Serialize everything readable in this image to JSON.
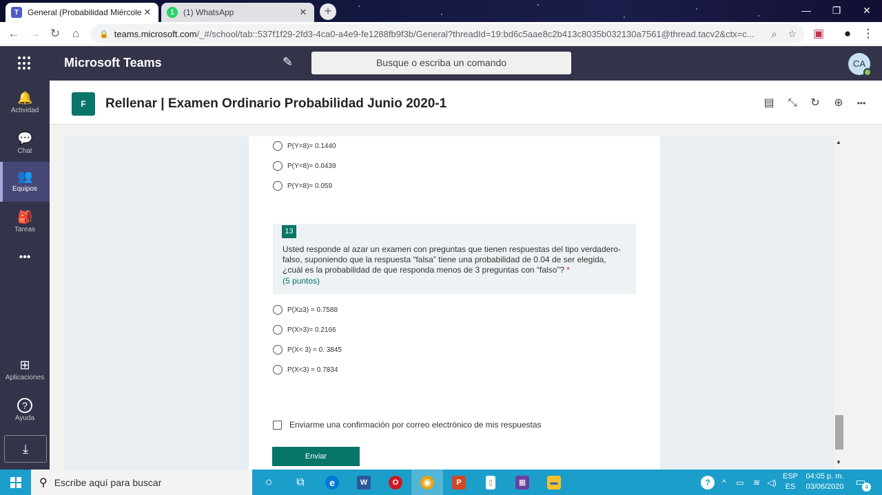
{
  "browser": {
    "tabs": [
      {
        "title": "General (Probabilidad Miércoles",
        "close": "✕",
        "active": true
      },
      {
        "title": "(1) WhatsApp",
        "badge": "1",
        "close": "✕",
        "active": false
      }
    ],
    "new_tab": "+",
    "window_controls": {
      "minimize": "—",
      "maximize": "❐",
      "close": "✕"
    },
    "nav": {
      "back": "←",
      "forward": "→",
      "reload": "↻",
      "home": "⌂"
    },
    "url_host": "teams.microsoft.com",
    "url_path": "/_#/school/tab::537f1f29-2fd3-4ca0-a4e9-fe1288fb9f3b/General?threadId=19:bd6c5aae8c2b413c8035b032130a7561@thread.tacv2&ctx=c...",
    "omnibox_icons": [
      "zoom-icon",
      "star-icon",
      "pocket-icon",
      "account-icon",
      "menu-icon"
    ]
  },
  "teams": {
    "app_title": "Microsoft Teams",
    "search_placeholder": "Busque o escriba un comando",
    "avatar_initials": "CA",
    "rail": [
      {
        "label": "Actividad",
        "icon": "bell-icon",
        "glyph": "🔔"
      },
      {
        "label": "Chat",
        "icon": "chat-icon",
        "glyph": "💬"
      },
      {
        "label": "Equipos",
        "icon": "teams-icon",
        "glyph": "👥",
        "active": true
      },
      {
        "label": "Tareas",
        "icon": "backpack-icon",
        "glyph": "🎒"
      },
      {
        "label": "•••",
        "icon": "more-icon",
        "glyph": ""
      },
      {
        "label": "Aplicaciones",
        "icon": "apps-icon",
        "glyph": "⊞"
      },
      {
        "label": "Ayuda",
        "icon": "help-icon",
        "glyph": "?"
      }
    ],
    "download_glyph": "⤓"
  },
  "channel": {
    "title": "Rellenar | Examen Ordinario Probabilidad Junio 2020-1",
    "logo_letter": "F",
    "header_icons": {
      "conversation": "▤",
      "collapse": "⤡",
      "refresh": "↻",
      "globe": "⊕",
      "more": "•••"
    }
  },
  "form": {
    "prev_options": [
      "P(Y=8)= 0.1440",
      "P(Y=8)= 0.0439",
      "P(Y=8)= 0.059"
    ],
    "question": {
      "number": "13",
      "text": "Usted responde al azar un examen con preguntas que tienen respuestas del tipo verdadero-falso, suponiendo que la respuesta “falsa” tiene una probabilidad de 0.04 de ser elegida, ¿cuál es la probabilidad de que responda menos de 3 preguntas con “falso”?",
      "required_mark": "*",
      "points": "(5 puntos)"
    },
    "options": [
      "P(X≥3) = 0.7588",
      "P(X>3)= 0.2166",
      "P(X< 3) = 0. 3845",
      "P(X<3) = 0.7834"
    ],
    "email_confirm": "Enviarme una confirmación por correo electrónico de mis respuestas",
    "submit_label": "Enviar"
  },
  "taskbar": {
    "search_placeholder": "Escribe aquí para buscar",
    "apps": [
      {
        "name": "cortana",
        "glyph": "○",
        "color": "transparent"
      },
      {
        "name": "task-view",
        "glyph": "⧉",
        "color": "transparent"
      },
      {
        "name": "edge",
        "glyph": "e",
        "color": "#0078d7"
      },
      {
        "name": "word",
        "glyph": "W",
        "color": "#2b579a"
      },
      {
        "name": "opera",
        "glyph": "O",
        "color": "#cc1b22"
      },
      {
        "name": "chrome",
        "glyph": "◉",
        "color": "#e8a317",
        "active": true
      },
      {
        "name": "powerpoint",
        "glyph": "P",
        "color": "#d24726"
      },
      {
        "name": "notepad",
        "glyph": "▯",
        "color": "#ffffff"
      },
      {
        "name": "calculator",
        "glyph": "▦",
        "color": "#6b3fa0"
      },
      {
        "name": "file-explorer",
        "glyph": "▬",
        "color": "#f2c12e"
      }
    ],
    "lang_top": "ESP",
    "lang_bottom": "ES",
    "time": "04:05 p. m.",
    "date": "03/06/2020",
    "notification_count": "4"
  }
}
